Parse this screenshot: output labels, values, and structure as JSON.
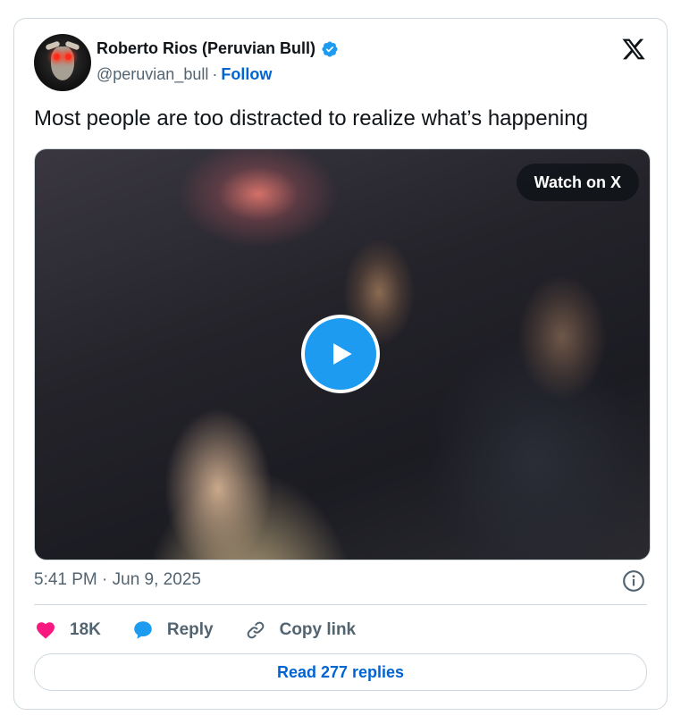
{
  "author": {
    "name": "Roberto Rios (Peruvian Bull)",
    "handle": "@peruvian_bull",
    "separator": "·",
    "follow_label": "Follow",
    "verified_icon": "verified-badge-icon",
    "verified_color": "#1d9bf0"
  },
  "brand": {
    "logo_icon": "x-logo-icon"
  },
  "tweet": {
    "text": "Most people are too distracted to realize what’s happening",
    "media": {
      "type": "video",
      "watch_label": "Watch on X",
      "play_icon": "play-icon"
    },
    "timestamp": "5:41 PM · Jun 9, 2025"
  },
  "actions": {
    "like": {
      "count": "18K",
      "icon": "heart-icon",
      "color": "#f91880"
    },
    "reply": {
      "label": "Reply",
      "icon": "speech-bubble-icon",
      "color": "#1d9bf0"
    },
    "copy": {
      "label": "Copy link",
      "icon": "link-icon"
    }
  },
  "read_replies": {
    "label": "Read 277 replies"
  },
  "colors": {
    "accent": "#0064d2",
    "muted": "#536471",
    "border": "#cfd9de"
  }
}
